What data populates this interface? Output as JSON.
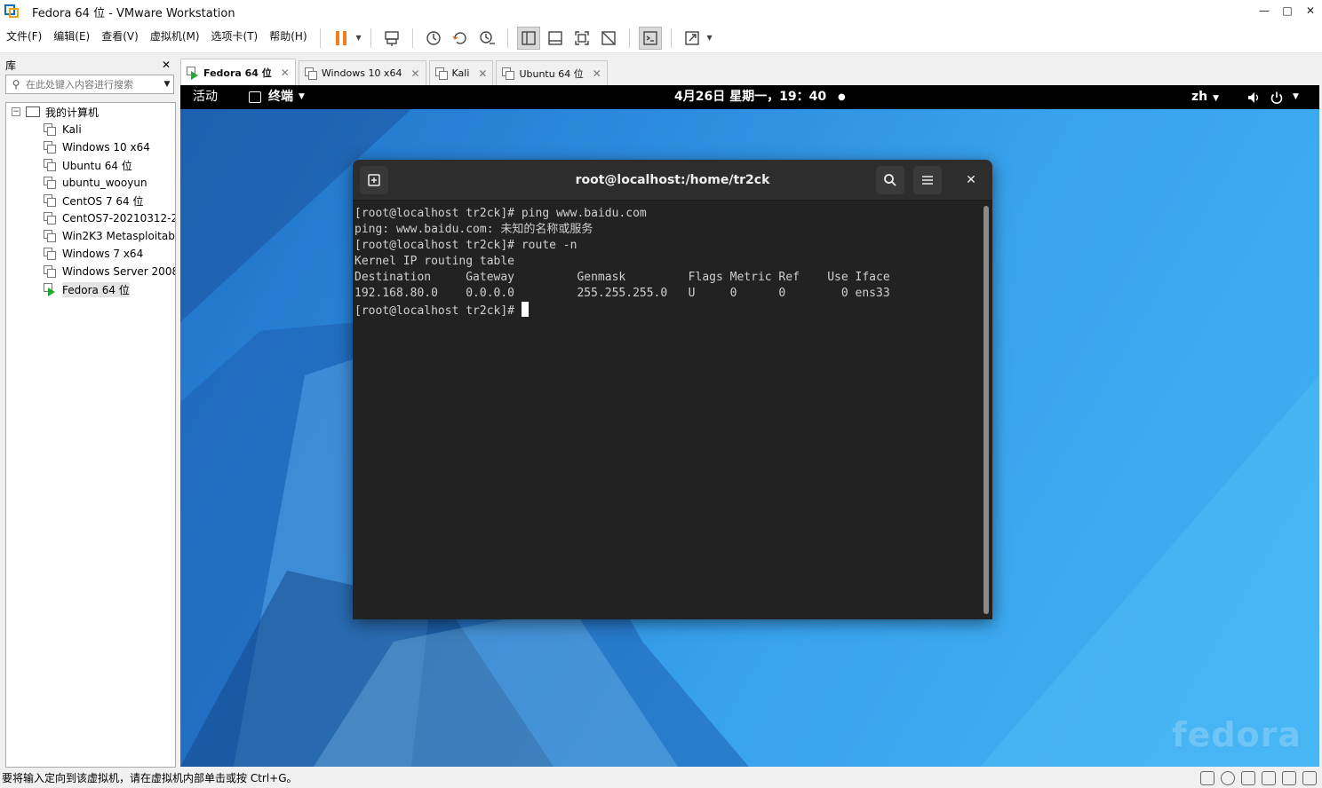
{
  "window": {
    "title": "Fedora 64 位 - VMware Workstation"
  },
  "menu": [
    "文件(F)",
    "编辑(E)",
    "查看(V)",
    "虚拟机(M)",
    "选项卡(T)",
    "帮助(H)"
  ],
  "library": {
    "title": "库",
    "search_placeholder": "在此处键入内容进行搜索",
    "root": "我的计算机",
    "items": [
      "Kali",
      "Windows 10 x64",
      "Ubuntu 64 位",
      "ubuntu_wooyun",
      "CentOS 7 64 位",
      "CentOS7-20210312-2",
      "Win2K3 Metasploitab",
      "Windows 7 x64",
      "Windows Server 2008",
      "Fedora 64 位"
    ]
  },
  "tabs": [
    "Fedora 64 位",
    "Windows 10 x64",
    "Kali",
    "Ubuntu 64 位"
  ],
  "gnome": {
    "activities": "活动",
    "app_menu": "终端",
    "clock": "4月26日 星期一，19：40",
    "lang": "zh"
  },
  "terminal": {
    "title": "root@localhost:/home/tr2ck",
    "lines": [
      "[root@localhost tr2ck]# ping www.baidu.com",
      "ping: www.baidu.com: 未知的名称或服务",
      "[root@localhost tr2ck]# route -n",
      "Kernel IP routing table",
      "Destination     Gateway         Genmask         Flags Metric Ref    Use Iface",
      "192.168.80.0    0.0.0.0         255.255.255.0   U     0      0        0 ens33"
    ],
    "prompt": "[root@localhost tr2ck]# "
  },
  "wallpaper_logo": "fedora",
  "statusbar": "要将输入定向到该虚拟机，请在虚拟机内部单击或按 Ctrl+G。"
}
